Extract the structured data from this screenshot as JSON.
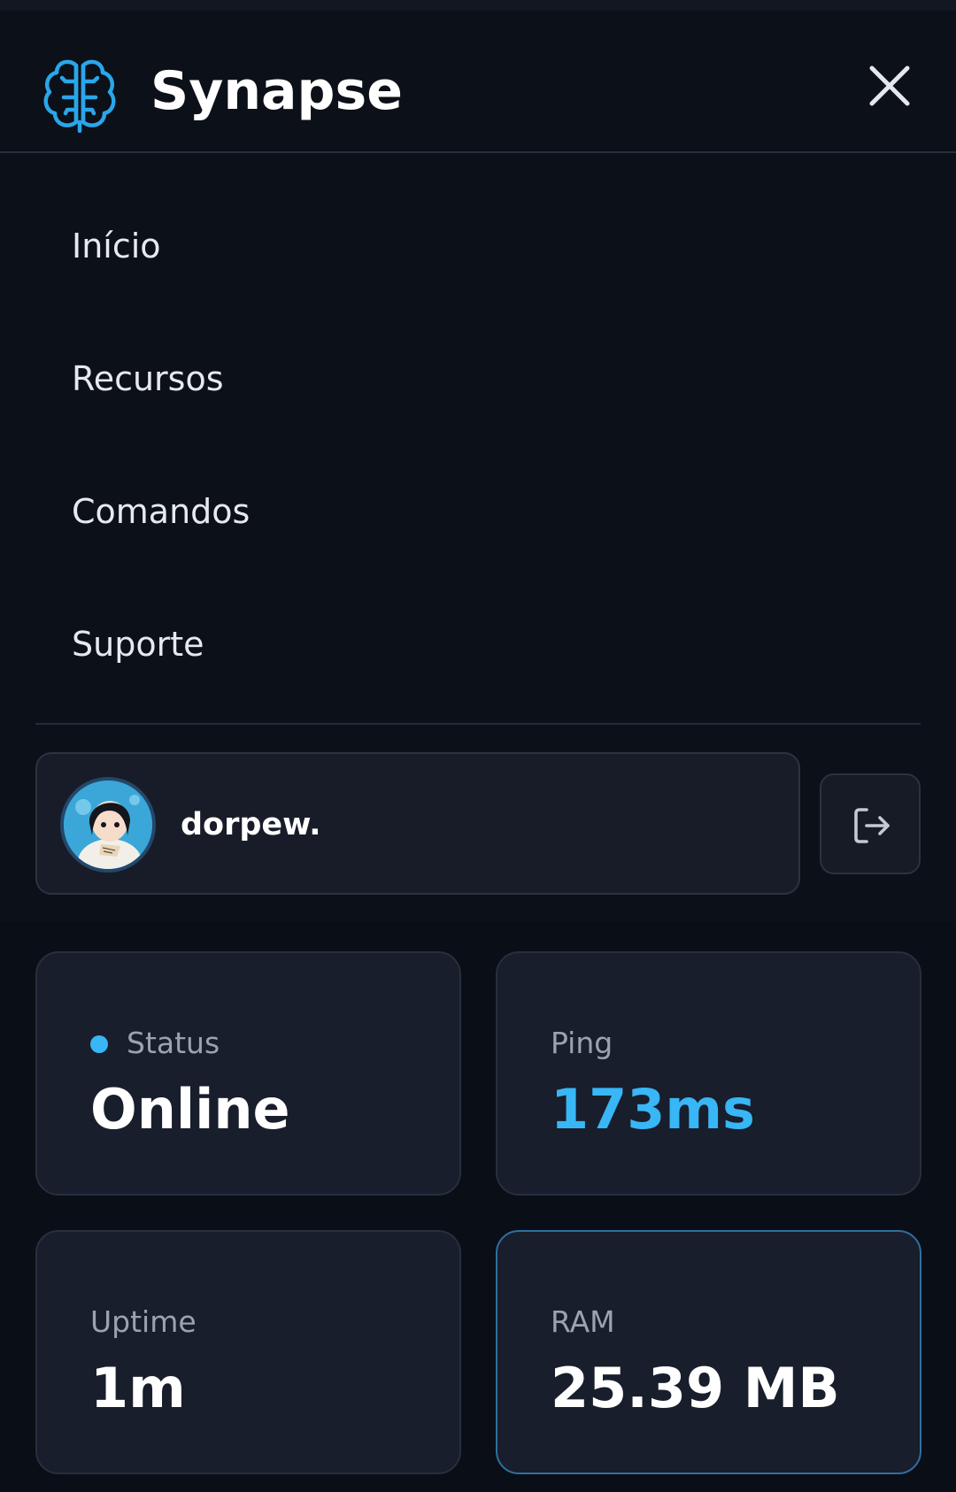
{
  "app": {
    "name": "Synapse",
    "accent_color": "#38b6f5"
  },
  "nav": {
    "items": [
      {
        "label": "Início"
      },
      {
        "label": "Recursos"
      },
      {
        "label": "Comandos"
      },
      {
        "label": "Suporte"
      }
    ]
  },
  "user": {
    "name": "dorpew."
  },
  "stats": {
    "status": {
      "label": "Status",
      "value": "Online"
    },
    "ping": {
      "label": "Ping",
      "value": "173ms"
    },
    "uptime": {
      "label": "Uptime",
      "value": "1m"
    },
    "ram": {
      "label": "RAM",
      "value": "25.39 MB"
    }
  },
  "icons": {
    "logo": "brain-circuit-icon",
    "close": "close-icon",
    "logout": "logout-icon"
  }
}
